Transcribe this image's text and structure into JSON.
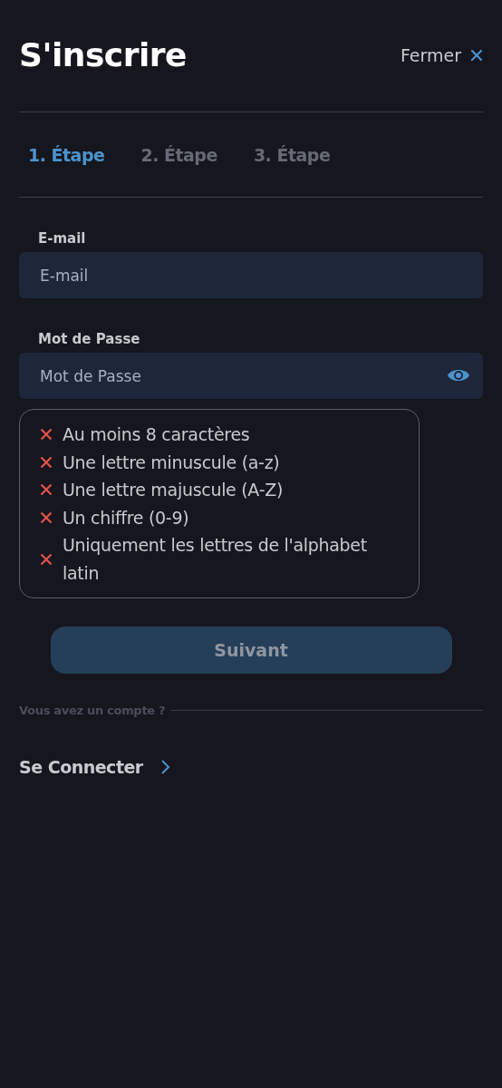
{
  "header": {
    "title": "S'inscrire",
    "close_label": "Fermer"
  },
  "steps": [
    {
      "label": "1. Étape",
      "selected": true
    },
    {
      "label": "2. Étape",
      "selected": false
    },
    {
      "label": "3. Étape",
      "selected": false
    }
  ],
  "fields": [
    {
      "label": "E-mail",
      "placeholder": "E-mail",
      "kind": "text"
    },
    {
      "label": "Mot de Passe",
      "placeholder": "Mot de Passe",
      "kind": "password"
    }
  ],
  "password_rules": [
    {
      "text": "Au moins 8 caractères",
      "met": false
    },
    {
      "text": "Une lettre minuscule (a-z)",
      "met": false
    },
    {
      "text": "Une lettre majuscule (A-Z)",
      "met": false
    },
    {
      "text": "Un chiffre (0-9)",
      "met": false
    },
    {
      "text": "Uniquement les lettres de l'alphabet latin",
      "met": false
    }
  ],
  "next_button": {
    "label": "Suivant",
    "disabled": true
  },
  "account_prompt": "Vous avez un compte ?",
  "login_link": "Se Connecter"
}
